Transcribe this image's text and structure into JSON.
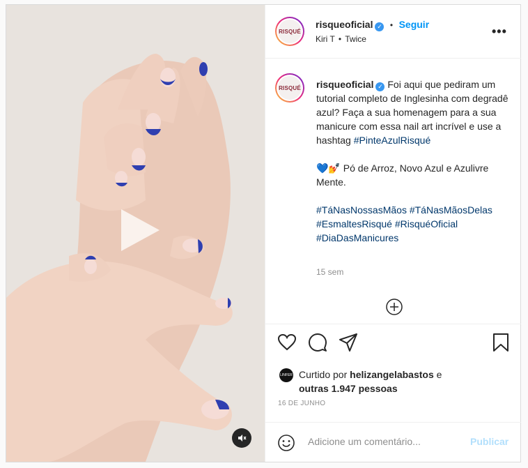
{
  "header": {
    "username": "risqueoficial",
    "verified_mark": "✓",
    "separator": "•",
    "follow_label": "Seguir",
    "audio_artist": "Kiri T",
    "audio_sep": "•",
    "audio_track": "Twice",
    "more_label": "•••",
    "avatar_text": "RISQUÉ"
  },
  "caption": {
    "username": "risqueoficial",
    "text_1": "Foi aqui que pediram um tutorial completo de Inglesinha com degradê azul? Faça a sua homenagem para a sua manicure com essa nail art incrível e use a hashtag",
    "hashtag_1": "#PinteAzulRisqué",
    "emoji": "💙💅",
    "text_2": "Pó de Arroz, Novo Azul e Azulivre Mente.",
    "hashtags": [
      "#TáNasNossasMãos",
      "#TáNasMãosDelas",
      "#EsmaltesRisqué",
      "#RisquéOficial",
      "#DiaDasManicures"
    ],
    "time": "15 sem"
  },
  "likes": {
    "prefix": "Curtido por",
    "user": "helizangelabastos",
    "suffix": "e",
    "others": "outras 1.947 pessoas",
    "avatar_text": "LINFER"
  },
  "date": "16 DE JUNHO",
  "comment": {
    "placeholder": "Adicione um comentário...",
    "publish_label": "Publicar"
  },
  "icons": [
    "heart-icon",
    "comment-icon",
    "share-icon",
    "bookmark-icon",
    "emoji-icon",
    "add-circle-icon",
    "play-icon",
    "mute-icon"
  ],
  "colors": {
    "accent": "#0095f6",
    "verified": "#3897f0",
    "nail_blue": "#2f3fb0"
  }
}
